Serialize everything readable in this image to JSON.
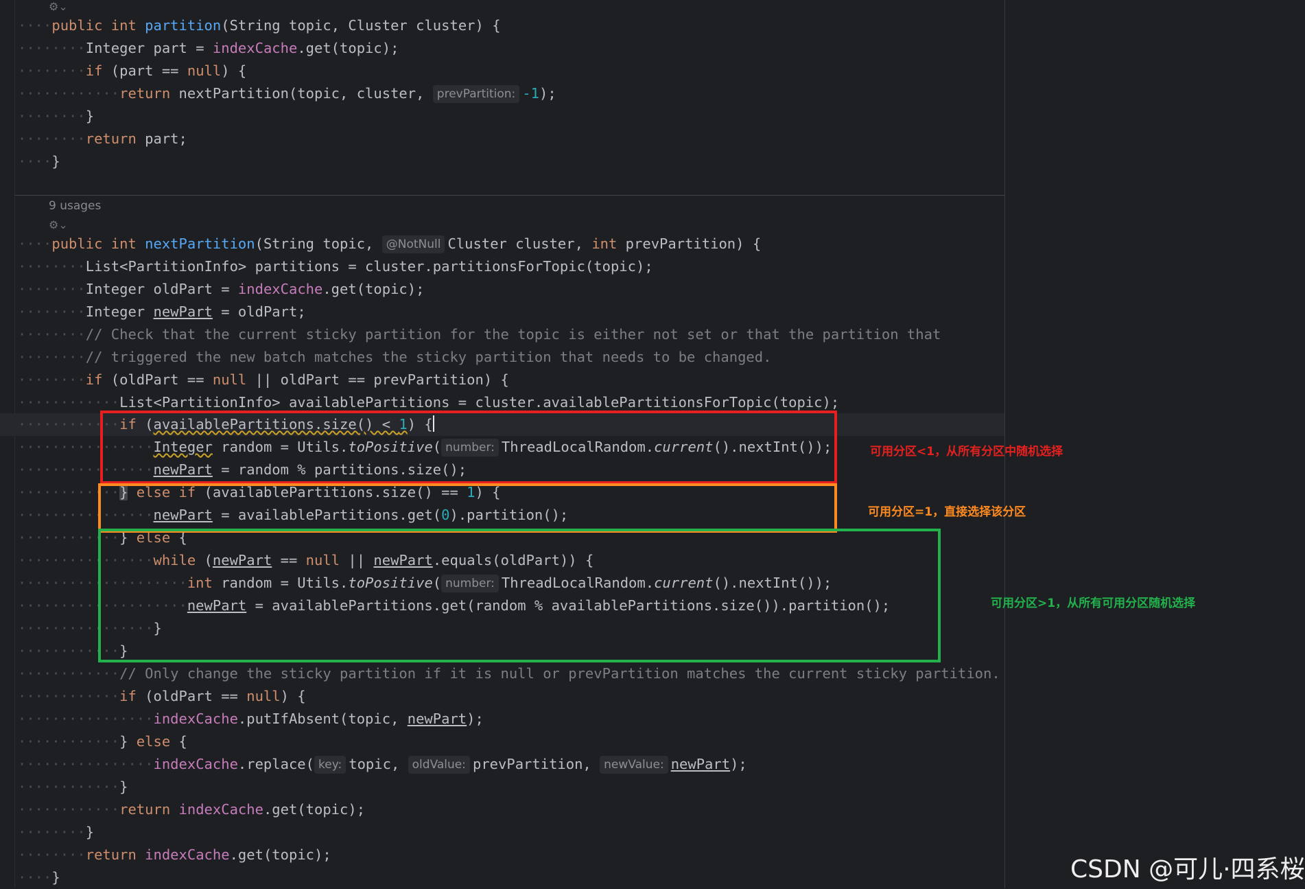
{
  "editor": {
    "usages_label": "9 usages",
    "gutter_icon": "inheritance-icon",
    "code": {
      "l1_a": "public",
      "l1_b": "int",
      "l1_c": "partition",
      "l1_d": "(String topic, Cluster cluster) {",
      "l2_a": "Integer part = ",
      "l2_b": "indexCache",
      "l2_c": ".get(topic);",
      "l3_a": "if",
      "l3_b": " (part == ",
      "l3_c": "null",
      "l3_d": ") {",
      "l4_a": "return",
      "l4_b": " nextPartition(topic, cluster, ",
      "l4_hint": "prevPartition:",
      "l4_c": "-1",
      "l4_d": ");",
      "l5": "}",
      "l6_a": "return",
      "l6_b": " part;",
      "l7": "}",
      "m1_a": "public",
      "m1_b": "int",
      "m1_c": "nextPartition",
      "m1_d": "(String topic, ",
      "m1_hint": "@NotNull",
      "m1_e": "Cluster cluster, ",
      "m1_f": "int",
      "m1_g": " prevPartition) {",
      "m2": "List<PartitionInfo> partitions = cluster.partitionsForTopic(topic);",
      "m3_a": "Integer oldPart = ",
      "m3_b": "indexCache",
      "m3_c": ".get(topic);",
      "m4_a": "Integer ",
      "m4_b": "newPart",
      "m4_c": " = oldPart;",
      "m5": "// Check that the current sticky partition for the topic is either not set or that the partition that",
      "m6": "// triggered the new batch matches the sticky partition that needs to be changed.",
      "m7_a": "if",
      "m7_b": " (oldPart == ",
      "m7_c": "null",
      "m7_d": " || oldPart == prevPartition) {",
      "m8": "List<PartitionInfo> availablePartitions = cluster.availablePartitionsForTopic(topic);",
      "m9_a": "if",
      "m9_b": " (",
      "m9_c": "availablePartitions.size() < ",
      "m9_d": "1",
      "m9_e": ") {",
      "m10_a": "Integer",
      "m10_b": " random = Utils.",
      "m10_c": "toPositive",
      "m10_d": "(",
      "m10_hint": "number:",
      "m10_e": "ThreadLocalRandom.",
      "m10_f": "current",
      "m10_g": "().nextInt());",
      "m11_a": "newPart",
      "m11_b": " = random % partitions.size();",
      "m12_a": "}",
      "m12_b": " else if",
      "m12_c": " (availablePartitions.size() == ",
      "m12_d": "1",
      "m12_e": ") {",
      "m13_a": "newPart",
      "m13_b": " = availablePartitions.get(",
      "m13_c": "0",
      "m13_d": ").partition();",
      "m14_a": "} ",
      "m14_b": "else",
      "m14_c": " {",
      "m15_a": "while",
      "m15_b": " (",
      "m15_c": "newPart",
      "m15_d": " == ",
      "m15_e": "null",
      "m15_f": " || ",
      "m15_g": "newPart",
      "m15_h": ".equals(oldPart)) {",
      "m16_a": "int",
      "m16_b": " random = Utils.",
      "m16_c": "toPositive",
      "m16_d": "(",
      "m16_hint": "number:",
      "m16_e": "ThreadLocalRandom.",
      "m16_f": "current",
      "m16_g": "().nextInt());",
      "m17_a": "newPart",
      "m17_b": " = availablePartitions.get(random % availablePartitions.size()).partition();",
      "m18": "}",
      "m19": "}",
      "m20": "// Only change the sticky partition if it is null or prevPartition matches the current sticky partition.",
      "m21_a": "if",
      "m21_b": " (oldPart == ",
      "m21_c": "null",
      "m21_d": ") {",
      "m22_a": "indexCache",
      "m22_b": ".putIfAbsent(topic, ",
      "m22_c": "newPart",
      "m22_d": ");",
      "m23_a": "} ",
      "m23_b": "else",
      "m23_c": " {",
      "m24_a": "indexCache",
      "m24_b": ".replace(",
      "m24_hint1": "key:",
      "m24_c": "topic, ",
      "m24_hint2": "oldValue:",
      "m24_d": "prevPartition, ",
      "m24_hint3": "newValue:",
      "m24_e": "newPart",
      "m24_f": ");",
      "m25": "}",
      "m26_a": "return",
      "m26_b": "indexCache",
      "m26_c": ".get(topic);",
      "m27": "}",
      "m28_a": "return",
      "m28_b": "indexCache",
      "m28_c": ".get(topic);",
      "m29": "}"
    }
  },
  "annotations": {
    "red_note": "可用分区<1，从所有分区中随机选择",
    "orange_note": "可用分区=1，直接选择该分区",
    "green_note": "可用分区>1，从所有可用分区随机选择",
    "red_color": "#e5201f",
    "orange_color": "#ff8a1f",
    "green_color": "#22b14c"
  },
  "watermark": "CSDN @可儿·四系桜"
}
